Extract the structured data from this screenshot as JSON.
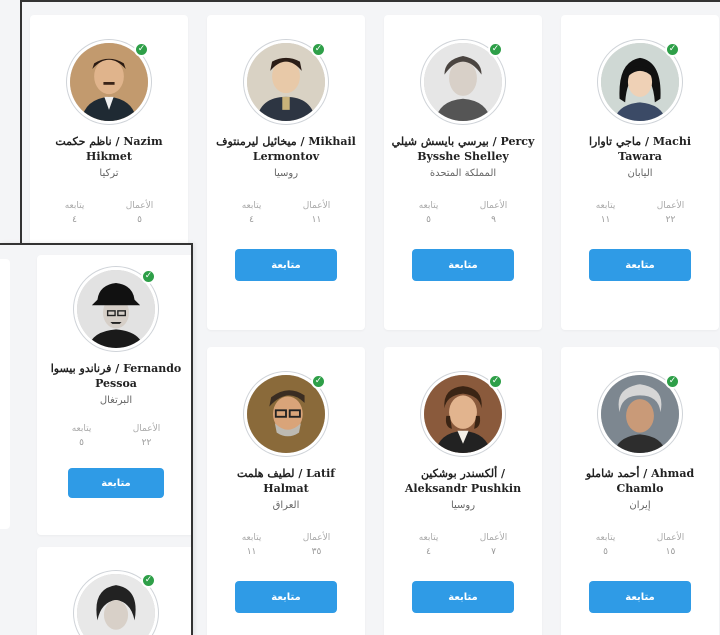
{
  "labels": {
    "works": "الأعمال",
    "followers": "يتابعه",
    "follow_button": "متابعة"
  },
  "cards": [
    {
      "name": "ناظم حكمت / Nazim Hikmet",
      "country": "تركيا",
      "works": "٥",
      "followers": "٤"
    },
    {
      "name": "ميخائيل ليرمنتوف / Mikhail Lermontov",
      "country": "روسيا",
      "works": "١١",
      "followers": "٤"
    },
    {
      "name": "بيرسي بايسش شيلي / Percy Bysshe Shelley",
      "country": "المملكة المتحدة",
      "works": "٩",
      "followers": "٥"
    },
    {
      "name": "ماجي تاوارا / Machi Tawara",
      "country": "اليابان",
      "works": "٢٢",
      "followers": "١١"
    },
    {
      "name": "لطيف هلمت / Latif Halmat",
      "country": "العراق",
      "works": "٣٥",
      "followers": "١١"
    },
    {
      "name": "ألكسندر بوشكين / Aleksandr Pushkin",
      "country": "روسيا",
      "works": "٧",
      "followers": "٤"
    },
    {
      "name": "أحمد شاملو / Ahmad Chamlo",
      "country": "إيران",
      "works": "١٥",
      "followers": "٥"
    }
  ],
  "front_cards": [
    {
      "name": "فرناندو بيسوا / Fernando Pessoa",
      "country": "البرتغال",
      "works": "٢٢",
      "followers": "٥"
    }
  ]
}
